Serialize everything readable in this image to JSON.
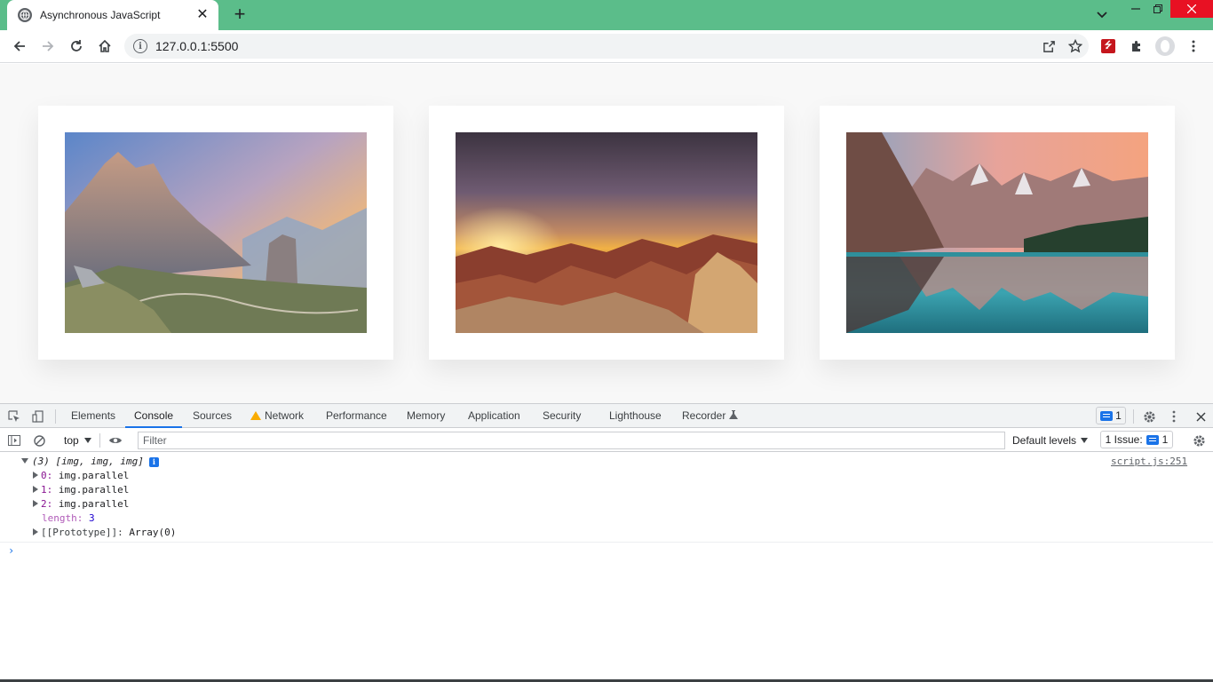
{
  "browser": {
    "tab_title": "Asynchronous JavaScript",
    "url": "127.0.0.1:5500",
    "accent_color": "#5bbd8a"
  },
  "page": {
    "cards": [
      {
        "image_name": "mountain-landscape-photo"
      },
      {
        "image_name": "sunset-desert-photo"
      },
      {
        "image_name": "lake-reflection-photo"
      }
    ]
  },
  "devtools": {
    "tabs": [
      "Elements",
      "Console",
      "Sources",
      "Network",
      "Performance",
      "Memory",
      "Application",
      "Security",
      "Lighthouse",
      "Recorder"
    ],
    "active_tab": "Console",
    "message_count": "1",
    "context": "top",
    "filter_placeholder": "Filter",
    "levels_label": "Default levels",
    "issues_label": "1 Issue:",
    "issues_count": "1"
  },
  "console": {
    "summary": "(3) [img, img, img]",
    "source": "script.js:251",
    "entries": [
      {
        "key": "0:",
        "value": "img.parallel"
      },
      {
        "key": "1:",
        "value": "img.parallel"
      },
      {
        "key": "2:",
        "value": "img.parallel"
      }
    ],
    "length_key": "length:",
    "length_value": "3",
    "prototype_key": "[[Prototype]]:",
    "prototype_value": "Array(0)"
  }
}
